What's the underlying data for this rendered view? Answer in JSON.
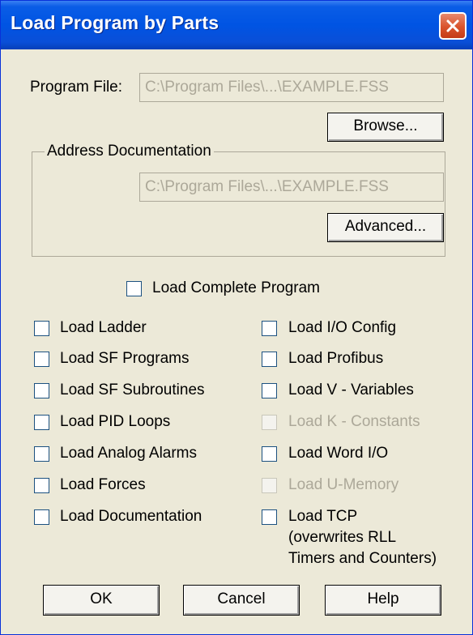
{
  "window": {
    "title": "Load Program by Parts"
  },
  "program_file": {
    "label": "Program File:",
    "value": "C:\\Program Files\\...\\EXAMPLE.FSS"
  },
  "browse_label": "Browse...",
  "address_doc": {
    "legend": "Address Documentation",
    "value": "C:\\Program Files\\...\\EXAMPLE.FSS",
    "advanced_label": "Advanced..."
  },
  "load_complete": {
    "label": "Load Complete Program",
    "checked": false
  },
  "left_options": [
    {
      "label": "Load Ladder"
    },
    {
      "label": "Load SF Programs"
    },
    {
      "label": "Load SF Subroutines"
    },
    {
      "label": "Load PID Loops"
    },
    {
      "label": "Load Analog Alarms"
    },
    {
      "label": "Load Forces"
    },
    {
      "label": "Load Documentation"
    }
  ],
  "right_options": [
    {
      "label": "Load I/O Config",
      "enabled": true
    },
    {
      "label": "Load Profibus",
      "enabled": true
    },
    {
      "label": "Load V - Variables",
      "enabled": true
    },
    {
      "label": "Load K - Constants",
      "enabled": false
    },
    {
      "label": "Load Word I/O",
      "enabled": true
    },
    {
      "label": "Load U-Memory",
      "enabled": false
    },
    {
      "label": "Load TCP",
      "note_line1": "(overwrites RLL",
      "note_line2": "Timers and Counters)",
      "enabled": true
    }
  ],
  "buttons": {
    "ok": "OK",
    "cancel": "Cancel",
    "help": "Help"
  },
  "colors": {
    "title_bar": "#0054e3",
    "dialog_bg": "#ece9d8",
    "disabled_text": "#aca899",
    "close_button": "#d9532c"
  }
}
